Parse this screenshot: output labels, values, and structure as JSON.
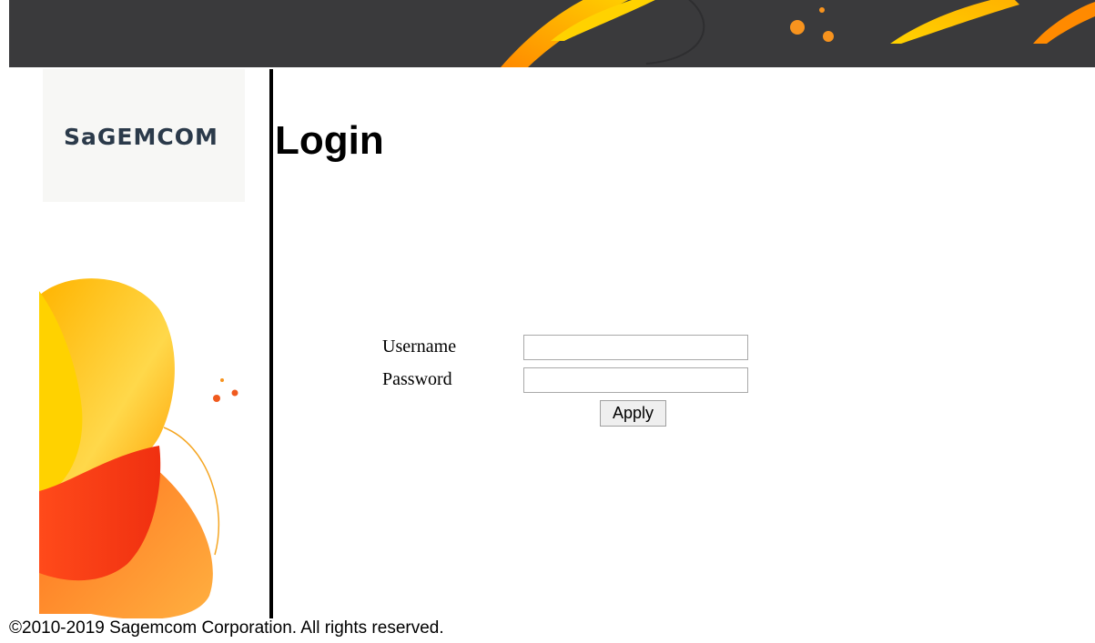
{
  "header": {
    "banner_color": "#3a3a3c",
    "accent_colors": [
      "#ffd200",
      "#ff8a00",
      "#f05a1e"
    ]
  },
  "sidebar": {
    "logo_text": "SaGEMCOM"
  },
  "main": {
    "title": "Login",
    "form": {
      "username_label": "Username",
      "username_value": "",
      "password_label": "Password",
      "password_value": "",
      "apply_label": "Apply"
    }
  },
  "footer": {
    "copyright": "©2010-2019 Sagemcom Corporation. All rights reserved."
  }
}
